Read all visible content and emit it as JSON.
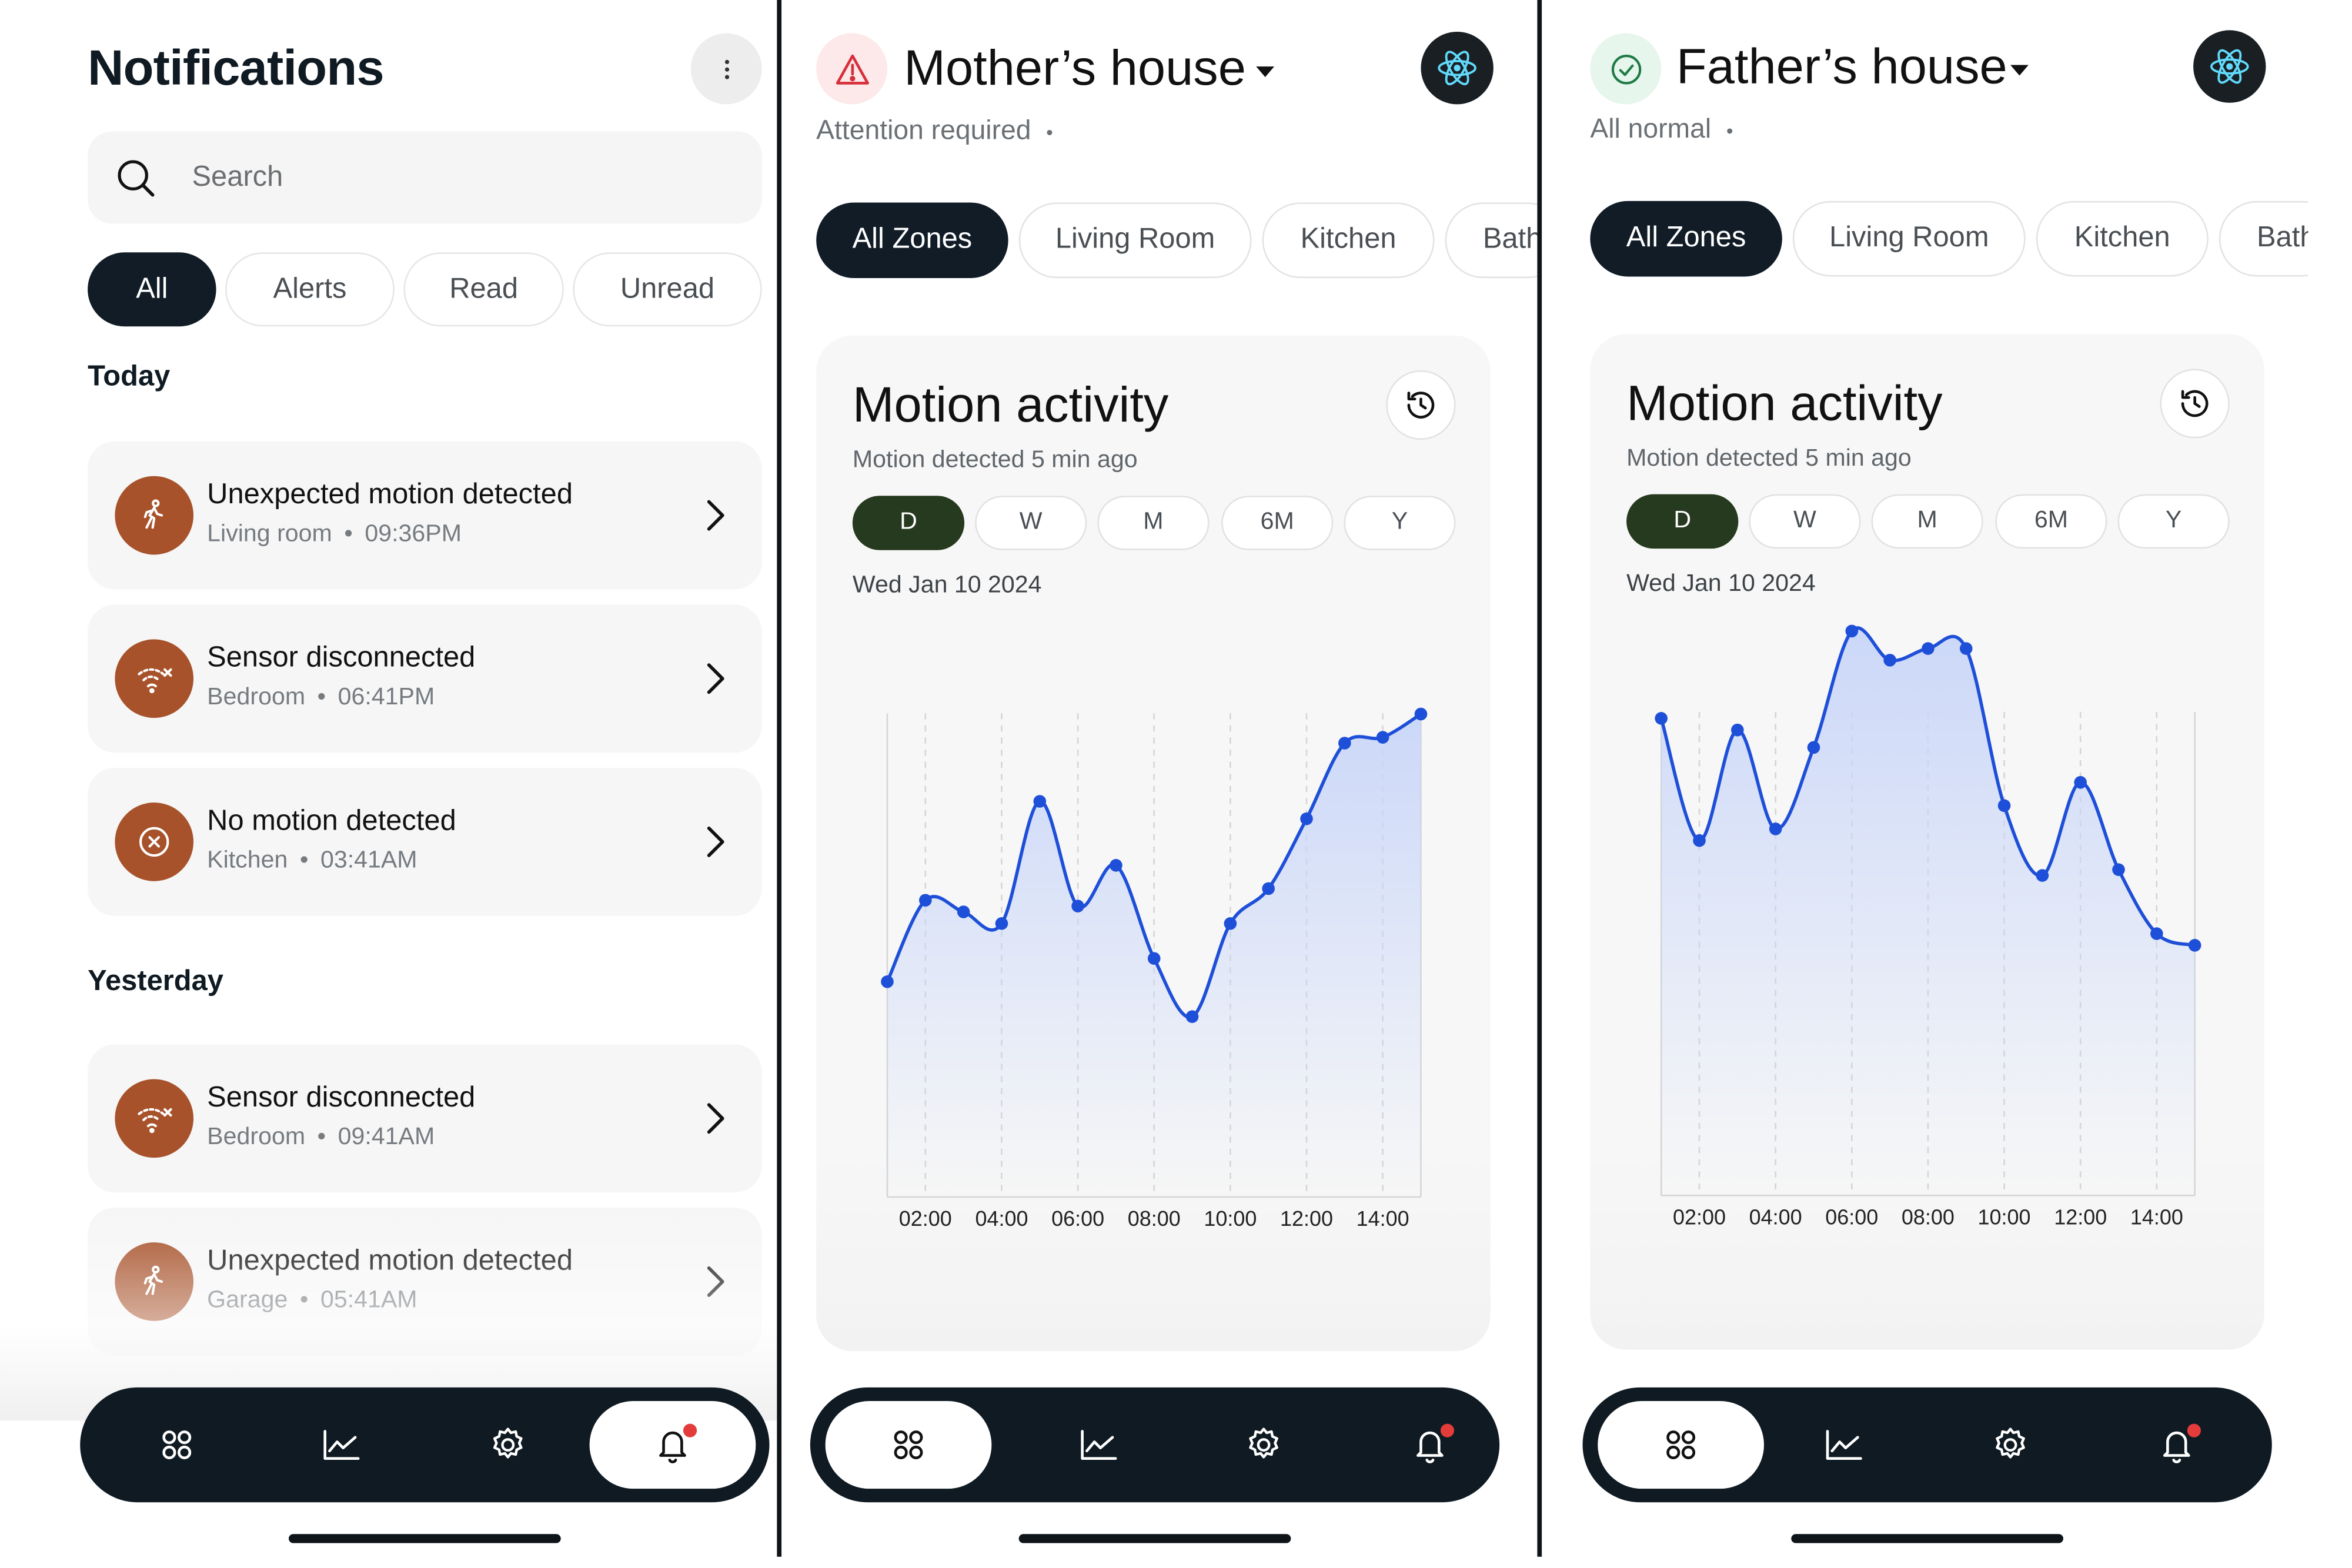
{
  "notifications": {
    "title": "Notifications",
    "more_icon": "ellipsis-vertical-icon",
    "search": {
      "placeholder": "Search",
      "icon": "search-icon"
    },
    "filters": [
      {
        "label": "All",
        "active": true
      },
      {
        "label": "Alerts",
        "active": false
      },
      {
        "label": "Read",
        "active": false
      },
      {
        "label": "Unread",
        "active": false
      }
    ],
    "sections": {
      "today": "Today",
      "yesterday": "Yesterday"
    },
    "items": [
      {
        "title": "Unexpected motion detected",
        "room": "Living room",
        "time": "09:36PM",
        "icon": "person-walking-icon",
        "section": "today"
      },
      {
        "title": "Sensor disconnected",
        "room": "Bedroom",
        "time": "06:41PM",
        "icon": "wifi-off-icon",
        "section": "today"
      },
      {
        "title": "No motion detected",
        "room": "Kitchen",
        "time": "03:41AM",
        "icon": "circle-x-icon",
        "section": "today"
      },
      {
        "title": "Sensor disconnected",
        "room": "Bedroom",
        "time": "09:41AM",
        "icon": "wifi-off-icon",
        "section": "yesterday"
      },
      {
        "title": "Unexpected motion detected",
        "room": "Garage",
        "time": "05:41AM",
        "icon": "person-walking-icon",
        "section": "yesterday"
      }
    ],
    "separator": "•"
  },
  "nav": {
    "items": [
      {
        "name": "dashboard",
        "icon": "grid-icon"
      },
      {
        "name": "analytics",
        "icon": "line-chart-icon"
      },
      {
        "name": "settings",
        "icon": "gear-icon"
      },
      {
        "name": "notifications",
        "icon": "bell-icon"
      }
    ]
  },
  "houses": [
    {
      "name": "Mother’s house",
      "status": "Attention required",
      "status_icon": "warning-triangle-icon",
      "status_color": "#d62f3a",
      "status_bg": "#fde8ea",
      "zones": [
        "All Zones",
        "Living Room",
        "Kitchen",
        "Bath"
      ],
      "card": {
        "title": "Motion activity",
        "subtitle": "Motion detected 5 min ago",
        "ranges": [
          "D",
          "W",
          "M",
          "6M",
          "Y"
        ],
        "active_range": "D",
        "date": "Wed Jan 10 2024"
      }
    },
    {
      "name": "Father’s house",
      "status": "All normal",
      "status_icon": "check-circle-icon",
      "status_color": "#2f8a4f",
      "status_bg": "#e6f6ec",
      "zones": [
        "All Zones",
        "Living Room",
        "Kitchen",
        "Bath"
      ],
      "card": {
        "title": "Motion activity",
        "subtitle": "Motion detected 5 min ago",
        "ranges": [
          "D",
          "W",
          "M",
          "6M",
          "Y"
        ],
        "active_range": "D",
        "date": "Wed Jan 10 2024"
      }
    }
  ],
  "chart_data": [
    {
      "type": "area",
      "title": "Motion activity",
      "xlabel": "",
      "ylabel": "",
      "x_ticks": [
        "02:00",
        "04:00",
        "06:00",
        "08:00",
        "10:00",
        "12:00",
        "14:00"
      ],
      "x": [
        1,
        2,
        3,
        4,
        5,
        6,
        7,
        8,
        9,
        10,
        11,
        12,
        13,
        14,
        15
      ],
      "values": [
        37,
        51,
        49,
        47,
        68,
        50,
        57,
        41,
        31,
        47,
        53,
        65,
        78,
        79,
        83
      ],
      "xlim": [
        1,
        15
      ],
      "ylim": [
        0,
        100
      ],
      "grid": "vertical",
      "line_color": "#1e4fd8",
      "fill_color": "#c9d6f8"
    },
    {
      "type": "area",
      "title": "Motion activity",
      "xlabel": "",
      "ylabel": "",
      "x_ticks": [
        "02:00",
        "04:00",
        "06:00",
        "08:00",
        "10:00",
        "12:00",
        "14:00"
      ],
      "x": [
        1,
        2,
        3,
        4,
        5,
        6,
        7,
        8,
        9,
        10,
        11,
        12,
        13,
        14,
        15
      ],
      "values": [
        82,
        61,
        80,
        63,
        77,
        97,
        92,
        94,
        94,
        67,
        55,
        71,
        56,
        45,
        43
      ],
      "xlim": [
        1,
        15
      ],
      "ylim": [
        0,
        100
      ],
      "grid": "vertical",
      "line_color": "#1e4fd8",
      "fill_color": "#c9d6f8"
    }
  ]
}
